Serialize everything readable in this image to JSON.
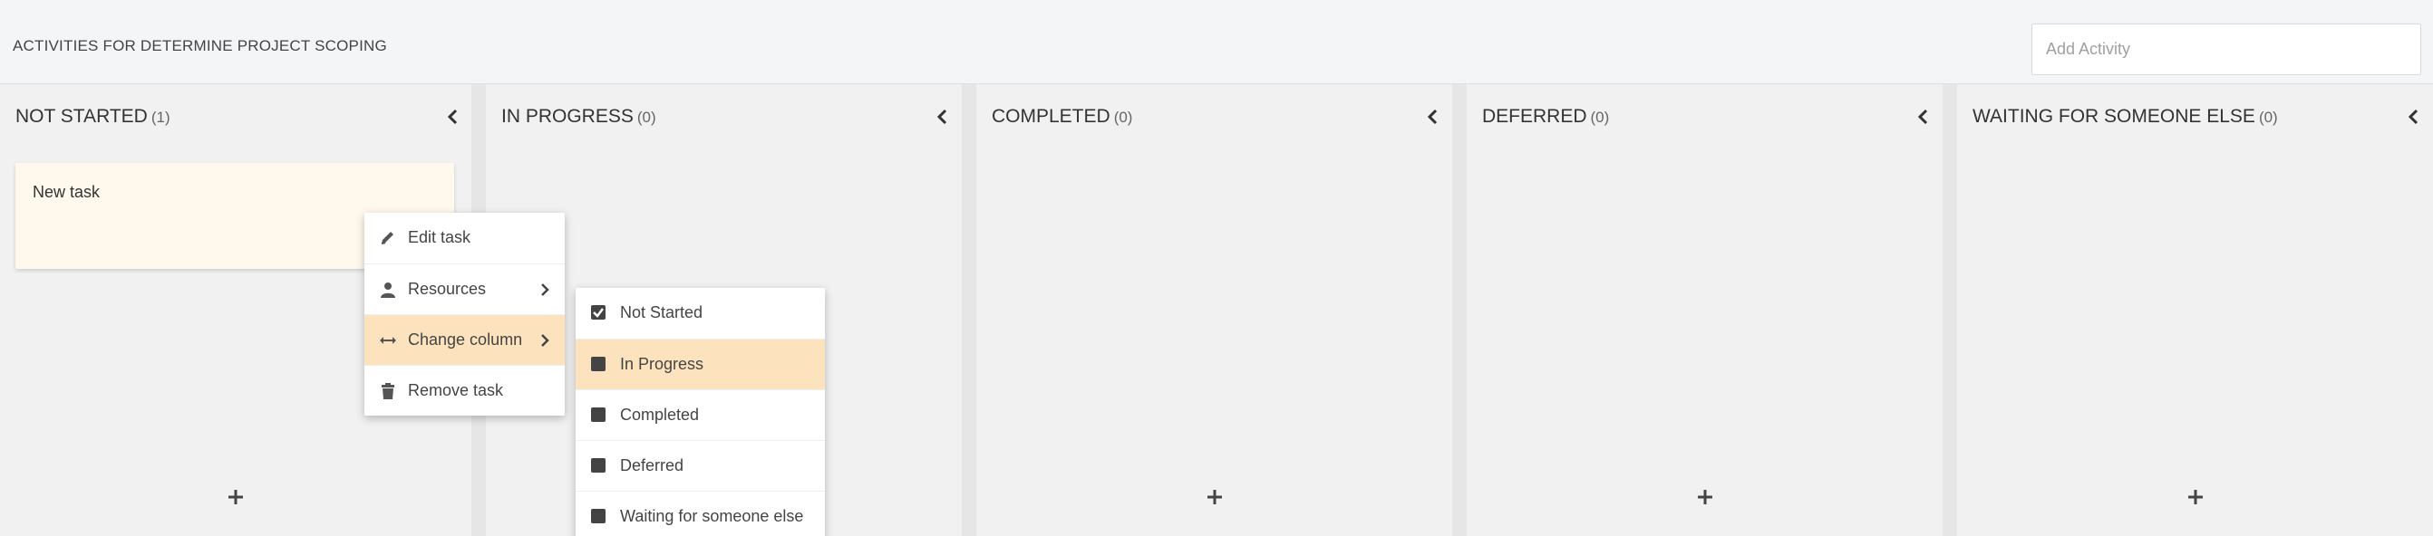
{
  "header": {
    "title": "ACTIVITIES FOR DETERMINE PROJECT SCOPING",
    "add_placeholder": "Add Activity"
  },
  "columns": [
    {
      "title": "NOT STARTED",
      "count": "(1)"
    },
    {
      "title": "IN PROGRESS",
      "count": "(0)"
    },
    {
      "title": "COMPLETED",
      "count": "(0)"
    },
    {
      "title": "DEFERRED",
      "count": "(0)"
    },
    {
      "title": "WAITING FOR SOMEONE ELSE",
      "count": "(0)"
    }
  ],
  "task": {
    "title": "New task"
  },
  "context_menu": {
    "items": [
      {
        "label": "Edit task",
        "icon": "pencil-icon"
      },
      {
        "label": "Resources",
        "icon": "user-icon"
      },
      {
        "label": "Change column",
        "icon": "arrows-horizontal-icon"
      },
      {
        "label": "Remove task",
        "icon": "trash-icon"
      }
    ]
  },
  "column_submenu": {
    "items": [
      {
        "label": "Not Started",
        "checked": true
      },
      {
        "label": "In Progress",
        "checked": false
      },
      {
        "label": "Completed",
        "checked": false
      },
      {
        "label": "Deferred",
        "checked": false
      },
      {
        "label": "Waiting for someone else",
        "checked": false
      }
    ]
  },
  "colors": {
    "accent_hover": "#fde3bd",
    "card_bg": "#fff8ec",
    "column_bg": "#f1f1f1",
    "column_separator": "#e6e6e6"
  }
}
